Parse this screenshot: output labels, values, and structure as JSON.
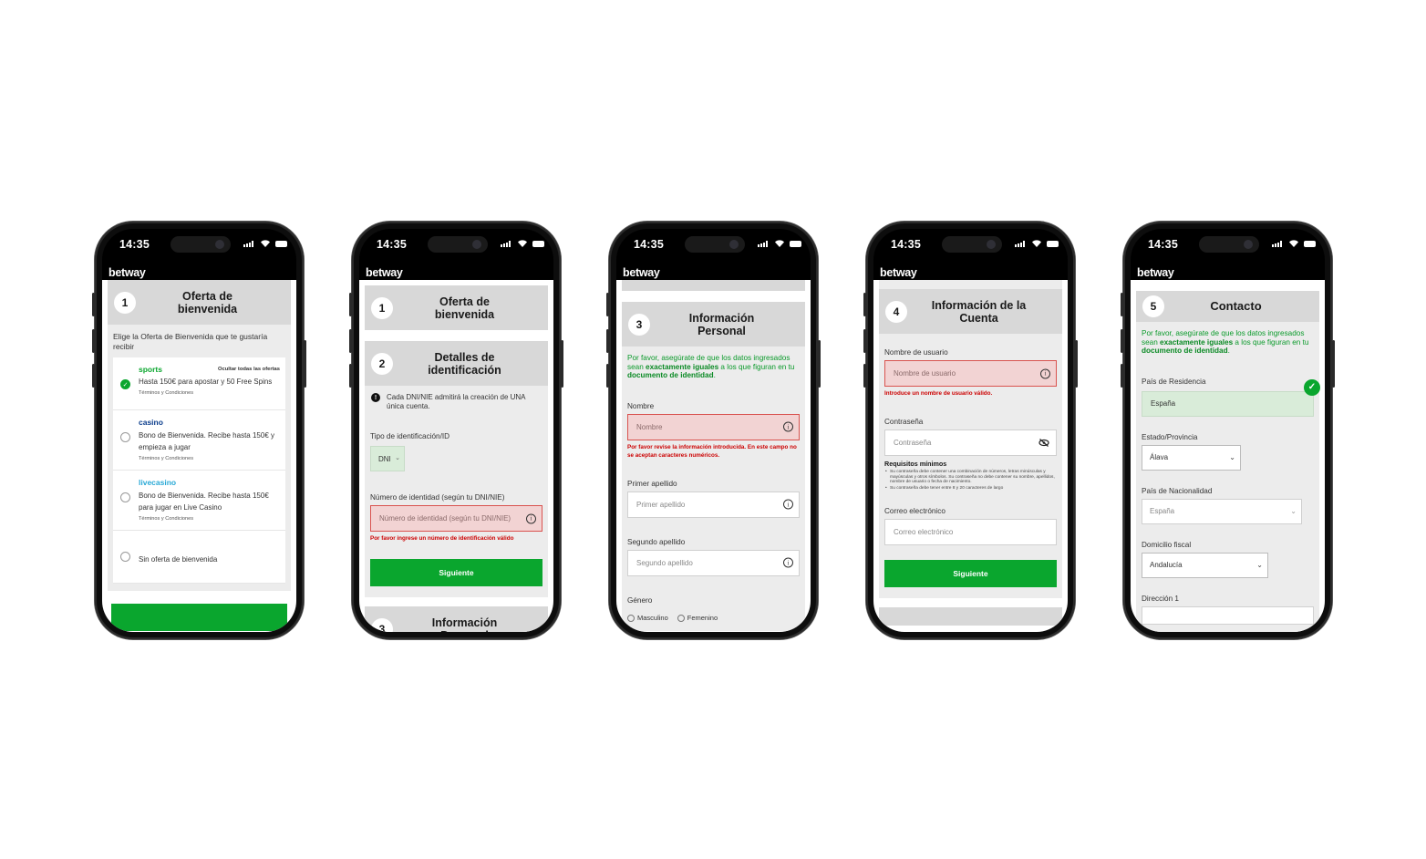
{
  "status": {
    "time": "14:35"
  },
  "brand": "betway",
  "phone1": {
    "step": {
      "num": "1",
      "title": "Oferta de bienvenida"
    },
    "intro": "Elige la Oferta de Bienvenida que te gustaría recibir",
    "hide_all": "Ocultar todas las ofertas",
    "offers": [
      {
        "title": "sports",
        "desc": "Hasta 150€ para apostar y 50 Free Spins",
        "terms": "Términos y Condiciones",
        "color": "#0aa62e",
        "selected": true
      },
      {
        "title": "casino",
        "desc": "Bono de Bienvenida. Recibe hasta 150€ y empieza a jugar",
        "terms": "Términos y Condiciones",
        "color": "#0b3d8c",
        "selected": false
      },
      {
        "title": "livecasino",
        "desc": "Bono de Bienvenida. Recibe hasta 150€ para jugar en Live Casino",
        "terms": "Términos y Condiciones",
        "color": "#29a9d6",
        "selected": false
      },
      {
        "title": "",
        "desc": "Sin oferta de bienvenida",
        "terms": "",
        "selected": false
      }
    ]
  },
  "phone2": {
    "step1": {
      "num": "1",
      "title": "Oferta de bienvenida"
    },
    "step2": {
      "num": "2",
      "title": "Detalles de identificación"
    },
    "notice": "Cada DNI/NIE admitirá la creación de UNA única cuenta.",
    "id_type_label": "Tipo de identificación/ID",
    "id_type_value": "DNI",
    "id_number_label": "Número de identidad (según tu DNI/NIE)",
    "id_number_placeholder": "Número de identidad (según tu DNI/NIE)",
    "id_error": "Por favor ingrese un número de identificación válido",
    "next": "Siguiente",
    "step3": {
      "num": "3",
      "title": "Información Personal"
    }
  },
  "phone3": {
    "step": {
      "num": "3",
      "title": "Información Personal"
    },
    "notice_pre": "Por favor, asegúrate de que los datos ingresados sean ",
    "notice_b1": "exactamente iguales",
    "notice_mid": " a los que figuran en tu ",
    "notice_b2": "documento de identidad",
    "notice_end": ".",
    "name_label": "Nombre",
    "name_placeholder": "Nombre",
    "name_error": "Por favor revise la información introducida. En este campo no se aceptan caracteres numéricos.",
    "surname1_label": "Primer apellido",
    "surname1_placeholder": "Primer apellido",
    "surname2_label": "Segundo apellido",
    "surname2_placeholder": "Segundo apellido",
    "gender_label": "Género",
    "gender_options": [
      "Masculino",
      "Femenino"
    ]
  },
  "phone4": {
    "step": {
      "num": "4",
      "title": "Información de la Cuenta"
    },
    "user_label": "Nombre de usuario",
    "user_placeholder": "Nombre de usuario",
    "user_error": "Introduce un nombre de usuario válido.",
    "pass_label": "Contraseña",
    "pass_placeholder": "Contraseña",
    "req_title": "Requisitos mínimos",
    "req1": "Su contraseña debe contener una combinación de números, letras minúsculas y mayúsculas y otros símbolos. Su contraseña no debe contener su nombre, apellidos, nombre de usuario o fecha de nacimiento.",
    "req2": "Su contraseña debe tener entre 8 y 20 caracteres de largo",
    "email_label": "Correo electrónico",
    "email_placeholder": "Correo electrónico",
    "next": "Siguiente"
  },
  "phone5": {
    "step": {
      "num": "5",
      "title": "Contacto"
    },
    "notice_pre": "Por favor, asegúrate de que los datos ingresados sean ",
    "notice_b1": "exactamente iguales",
    "notice_mid": " a los que figuran en tu ",
    "notice_b2": "documento de identidad",
    "notice_end": ".",
    "residence_label": "País de Residencia",
    "residence_value": "España",
    "state_label": "Estado/Provincia",
    "state_value": "Álava",
    "nationality_label": "País de Nacionalidad",
    "nationality_value": "España",
    "fiscal_label": "Domicilio fiscal",
    "fiscal_value": "Andalucía",
    "address_label": "Dirección 1"
  },
  "colors": {
    "green": "#0aa62e",
    "error": "#d9534f"
  }
}
